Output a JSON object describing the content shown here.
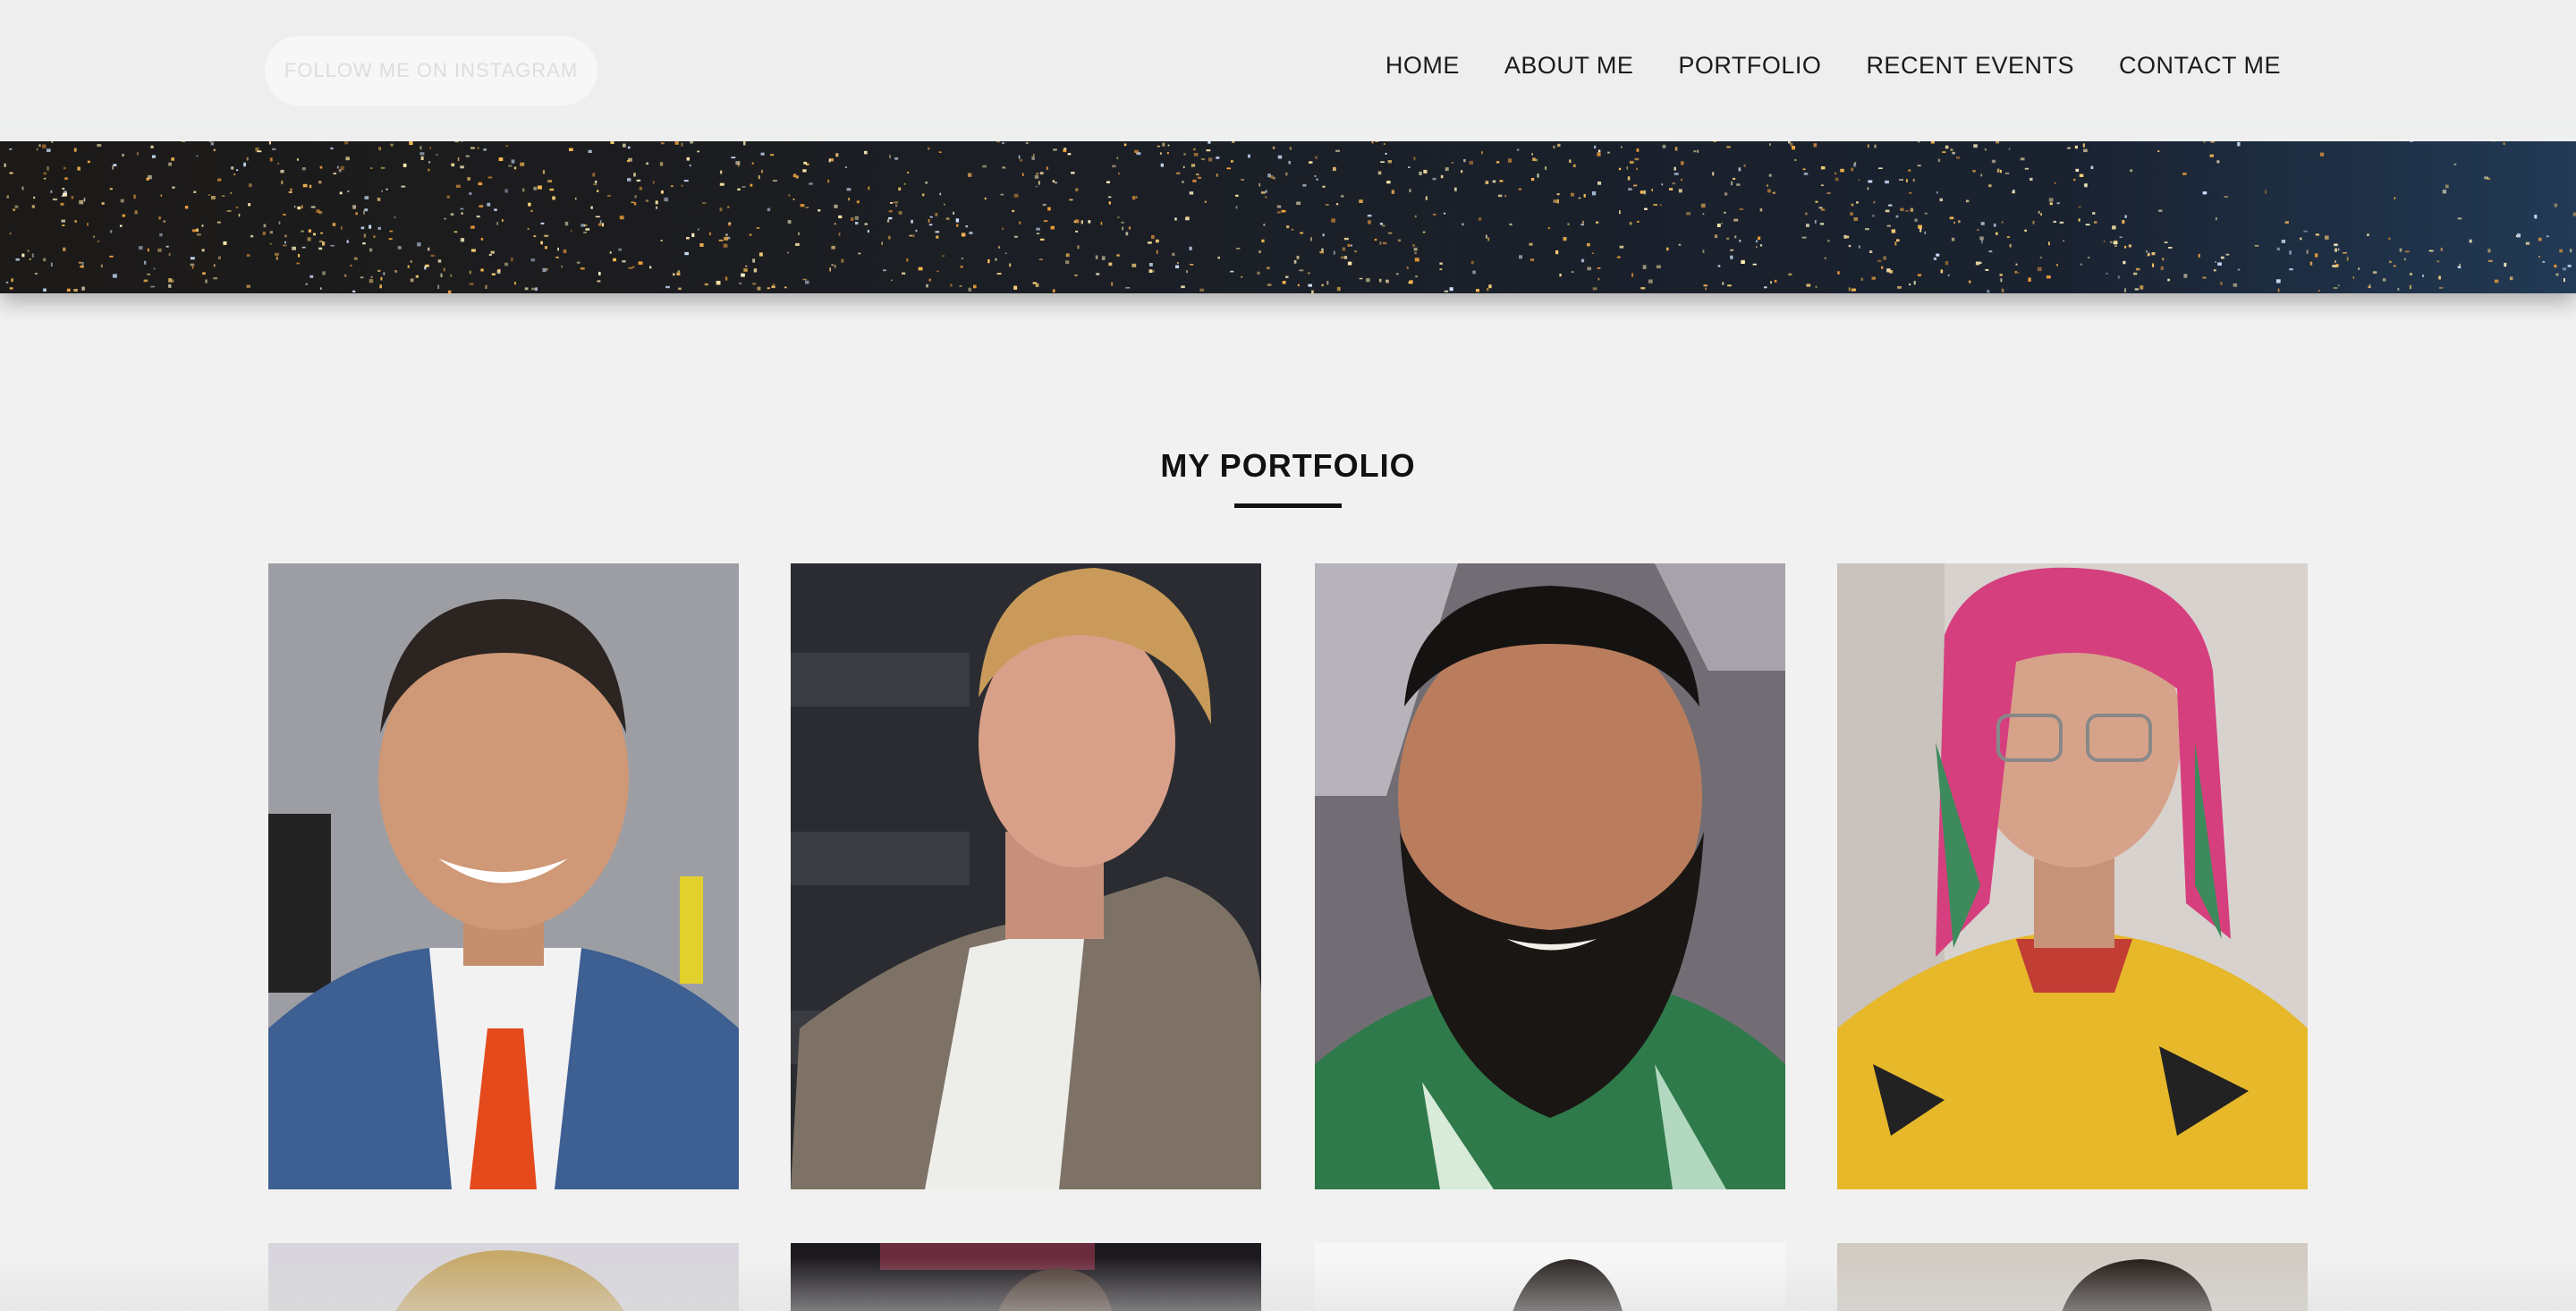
{
  "navbar": {
    "follow_button": "FOLLOW ME ON INSTAGRAM",
    "links": [
      "HOME",
      "ABOUT ME",
      "PORTFOLIO",
      "RECENT EVENTS",
      "CONTACT ME"
    ]
  },
  "hero": {
    "image": "city-skyline-at-night"
  },
  "portfolio": {
    "title": "MY PORTFOLIO",
    "photos": [
      {
        "subject": "smiling man in blue suit with orange tie",
        "icon": "portrait-photo"
      },
      {
        "subject": "blond man in tan jacket",
        "icon": "portrait-photo"
      },
      {
        "subject": "bearded man in green patterned shirt",
        "icon": "portrait-photo"
      },
      {
        "subject": "man with pink and green dreadlocks and aviator glasses",
        "icon": "portrait-photo"
      },
      {
        "subject": "man with tousled blond hair",
        "icon": "portrait-photo"
      },
      {
        "subject": "person in front of Ragnarok poster",
        "icon": "portrait-photo"
      },
      {
        "subject": "man on white background",
        "icon": "portrait-photo"
      },
      {
        "subject": "woman with dark hair",
        "icon": "portrait-photo"
      }
    ]
  },
  "colors": {
    "page_bg": "#f1f1f1",
    "nav_bg": "#f6f6f6",
    "text": "#1a1a1a",
    "accent_rule": "#111111"
  }
}
